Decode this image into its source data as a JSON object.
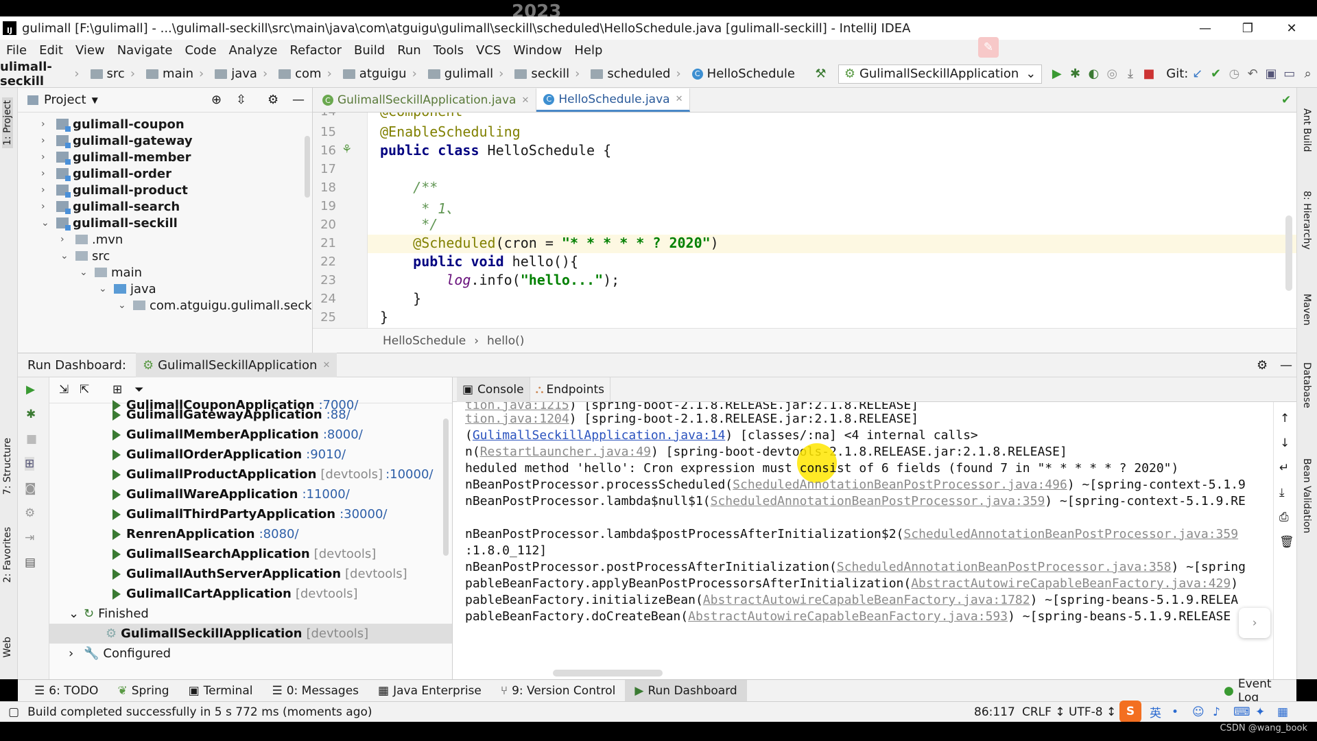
{
  "watermark_year": "2023",
  "window": {
    "title": "gulimall [F:\\gulimall] - ...\\gulimall-seckill\\src\\main\\java\\com\\atguigu\\gulimall\\seckill\\scheduled\\HelloSchedule.java [gulimall-seckill] - IntelliJ IDEA",
    "minimize": "—",
    "restore": "❐",
    "close": "✕"
  },
  "menu": [
    "File",
    "Edit",
    "View",
    "Navigate",
    "Code",
    "Analyze",
    "Refactor",
    "Build",
    "Run",
    "Tools",
    "VCS",
    "Window",
    "Help"
  ],
  "navbar": {
    "crumbs": [
      "ulimall-seckill",
      "src",
      "main",
      "java",
      "com",
      "atguigu",
      "gulimall",
      "seckill",
      "scheduled",
      "HelloSchedule"
    ],
    "run_config": "GulimallSeckillApplication",
    "git_label": "Git:"
  },
  "left_strip": [
    "1: Project",
    "7: Structure",
    "2: Favorites",
    "Web"
  ],
  "right_strip": [
    "Ant Build",
    "8: Hierarchy",
    "Maven",
    "Database",
    "Bean Validation"
  ],
  "project": {
    "header": "Project",
    "tree": [
      {
        "label": "gulimall-coupon",
        "type": "module",
        "expanded": false
      },
      {
        "label": "gulimall-gateway",
        "type": "module",
        "expanded": false
      },
      {
        "label": "gulimall-member",
        "type": "module",
        "expanded": false
      },
      {
        "label": "gulimall-order",
        "type": "module",
        "expanded": false
      },
      {
        "label": "gulimall-product",
        "type": "module",
        "expanded": false
      },
      {
        "label": "gulimall-search",
        "type": "module",
        "expanded": false
      },
      {
        "label": "gulimall-seckill",
        "type": "module",
        "expanded": true
      },
      {
        "label": ".mvn",
        "type": "folder",
        "expanded": false
      },
      {
        "label": "src",
        "type": "folder",
        "expanded": true
      },
      {
        "label": "main",
        "type": "folder",
        "expanded": true
      },
      {
        "label": "java",
        "type": "folder-blue",
        "expanded": true
      },
      {
        "label": "com.atguigu.gulimall.seckill",
        "type": "package",
        "expanded": true
      }
    ]
  },
  "editor": {
    "tabs": [
      {
        "label": "GulimallSeckillApplication.java",
        "active": false
      },
      {
        "label": "HelloSchedule.java",
        "active": true
      }
    ],
    "lines": [
      {
        "n": "14",
        "text": "@Component"
      },
      {
        "n": "15",
        "text": "@EnableScheduling"
      },
      {
        "n": "16",
        "text": "public class HelloSchedule {"
      },
      {
        "n": "17",
        "text": ""
      },
      {
        "n": "18",
        "text": "    /**"
      },
      {
        "n": "19",
        "text": "     * 1、"
      },
      {
        "n": "20",
        "text": "     */"
      },
      {
        "n": "21",
        "text": "    @Scheduled(cron = \"* * * * * ? 2020\")"
      },
      {
        "n": "22",
        "text": "    public void hello(){"
      },
      {
        "n": "23",
        "text": "        log.info(\"hello...\");"
      },
      {
        "n": "24",
        "text": "    }"
      },
      {
        "n": "25",
        "text": "}"
      }
    ],
    "breadcrumb": [
      "HelloSchedule",
      "hello()"
    ]
  },
  "run_dashboard": {
    "label": "Run Dashboard:",
    "tab": "GulimallSeckillApplication",
    "apps": [
      {
        "name": "GulimallCouponApplication",
        "meta": "",
        "port": ":7000/"
      },
      {
        "name": "GulimallGatewayApplication",
        "meta": "",
        "port": ":88/"
      },
      {
        "name": "GulimallMemberApplication",
        "meta": "",
        "port": ":8000/"
      },
      {
        "name": "GulimallOrderApplication",
        "meta": "",
        "port": ":9010/"
      },
      {
        "name": "GulimallProductApplication",
        "meta": "[devtools]",
        "port": ":10000/"
      },
      {
        "name": "GulimallWareApplication",
        "meta": "",
        "port": ":11000/"
      },
      {
        "name": "GulimallThirdPartyApplication",
        "meta": "",
        "port": ":30000/"
      },
      {
        "name": "RenrenApplication",
        "meta": "",
        "port": ":8080/"
      },
      {
        "name": "GulimallSearchApplication",
        "meta": "[devtools]",
        "port": ""
      },
      {
        "name": "GulimallAuthServerApplication",
        "meta": "[devtools]",
        "port": ""
      },
      {
        "name": "GulimallCartApplication",
        "meta": "[devtools]",
        "port": ""
      }
    ],
    "finished_label": "Finished",
    "finished_app": {
      "name": "GulimallSeckillApplication",
      "meta": "[devtools]"
    },
    "configured_label": "Configured"
  },
  "console": {
    "tabs": [
      "Console",
      "Endpoints"
    ],
    "lines": [
      {
        "pre": "",
        "link": "tion.java:1215",
        "post": ") [spring-boot-2.1.8.RELEASE.jar:2.1.8.RELEASE]"
      },
      {
        "pre": "",
        "link": "tion.java:1204",
        "post": ") [spring-boot-2.1.8.RELEASE.jar:2.1.8.RELEASE]"
      },
      {
        "pre": "(",
        "link": "GulimallSeckillApplication.java:14",
        "post": ") [classes/:na] <4 internal calls>"
      },
      {
        "pre": "n(",
        "link": "RestartLauncher.java:49",
        "post": ") [spring-boot-devtools-2.1.8.RELEASE.jar:2.1.8.RELEASE]"
      },
      {
        "pre": "heduled method 'hello': Cron expression must consist of 6 fields (found 7 in \"* * * * * ? 2020\")",
        "link": "",
        "post": ""
      },
      {
        "pre": "nBeanPostProcessor.processScheduled(",
        "link": "ScheduledAnnotationBeanPostProcessor.java:496",
        "post": ") ~[spring-context-5.1.9"
      },
      {
        "pre": "nBeanPostProcessor.lambda$null$1(",
        "link": "ScheduledAnnotationBeanPostProcessor.java:359",
        "post": ") ~[spring-context-5.1.9.RE"
      },
      {
        "pre": "",
        "link": "",
        "post": ""
      },
      {
        "pre": "nBeanPostProcessor.lambda$postProcessAfterInitialization$2(",
        "link": "ScheduledAnnotationBeanPostProcessor.java:359",
        "post": ""
      },
      {
        "pre": ":1.8.0_112]",
        "link": "",
        "post": ""
      },
      {
        "pre": "nBeanPostProcessor.postProcessAfterInitialization(",
        "link": "ScheduledAnnotationBeanPostProcessor.java:358",
        "post": ") ~[spring"
      },
      {
        "pre": "pableBeanFactory.applyBeanPostProcessorsAfterInitialization(",
        "link": "AbstractAutowireCapableBeanFactory.java:429",
        "post": ")"
      },
      {
        "pre": "pableBeanFactory.initializeBean(",
        "link": "AbstractAutowireCapableBeanFactory.java:1782",
        "post": ") ~[spring-beans-5.1.9.RELEA"
      },
      {
        "pre": "pableBeanFactory.doCreateBean(",
        "link": "AbstractAutowireCapableBeanFactory.java:593",
        "post": ") ~[spring-beans-5.1.9.RELEASE"
      }
    ]
  },
  "bottom_tools": [
    {
      "label": "6: TODO",
      "active": false
    },
    {
      "label": "Spring",
      "active": false
    },
    {
      "label": "Terminal",
      "active": false
    },
    {
      "label": "0: Messages",
      "active": false
    },
    {
      "label": "Java Enterprise",
      "active": false
    },
    {
      "label": "9: Version Control",
      "active": false
    },
    {
      "label": "Run Dashboard",
      "active": true
    }
  ],
  "event_log": "Event Log",
  "status": {
    "message": "Build completed successfully in 5 s 772 ms (moments ago)",
    "position": "86:117",
    "line_sep": "CRLF ↕",
    "encoding": "UTF-8 ↕",
    "ime": "英"
  },
  "csdn": "CSDN @wang_book",
  "colors": {
    "accent": "#4a88c7",
    "run_green": "#3a7a32",
    "highlight": "#ffe600"
  }
}
